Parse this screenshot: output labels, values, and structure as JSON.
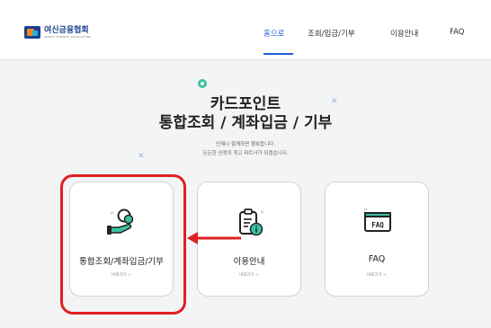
{
  "header": {
    "logo_title": "여신금융협회",
    "logo_subtitle": "CREDIT FINANCE ASSOCIATION",
    "nav": [
      {
        "label": "홈으로",
        "active": true
      },
      {
        "label": "조회/입금/기부",
        "active": false
      },
      {
        "label": "이용안내",
        "active": false
      },
      {
        "label": "FAQ",
        "active": false
      }
    ]
  },
  "hero": {
    "title_line1": "카드포인트",
    "title_line2": "통합조회 / 계좌입금 / 기부",
    "desc_line1": "언제나 함께하면 행복합니다.",
    "desc_line2": "든든한 신뢰의 최고 파트너가 되겠습니다."
  },
  "cards": [
    {
      "title": "통합조회/계좌입금/기부",
      "link": "바로가기 >",
      "icon": "hand-coin-icon"
    },
    {
      "title": "이용안내",
      "link": "바로가기 >",
      "icon": "clipboard-info-icon"
    },
    {
      "title": "FAQ",
      "link": "바로가기 >",
      "icon": "faq-window-icon"
    }
  ],
  "colors": {
    "accent": "#1f5fd6",
    "green": "#3ac1a2",
    "highlight": "#e02020"
  }
}
